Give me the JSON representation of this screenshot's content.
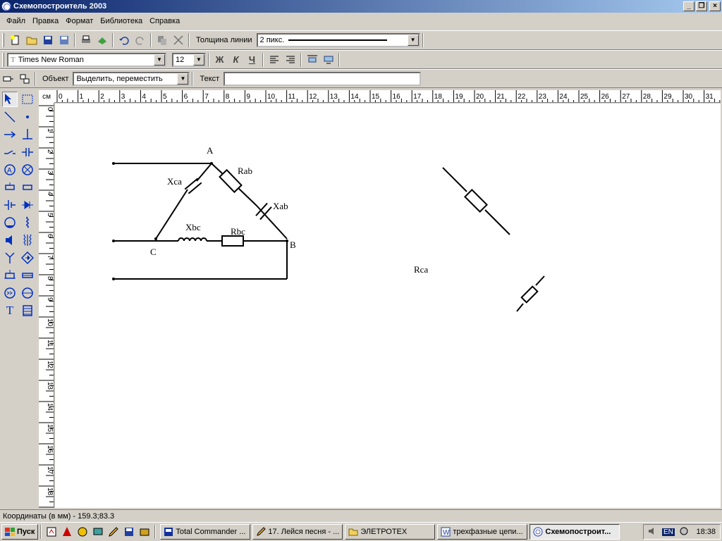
{
  "window": {
    "title": "Схемопостроитель 2003",
    "minimize": "_",
    "restore": "❐",
    "close": "×"
  },
  "menu": [
    "Файл",
    "Правка",
    "Формат",
    "Библиотека",
    "Справка"
  ],
  "toolbar1": {
    "line_width_label": "Толщина линии",
    "line_width_value": "2 пикс."
  },
  "toolbar2": {
    "font_name": "Times New Roman",
    "font_size": "12",
    "bold": "Ж",
    "italic": "К",
    "underline": "Ч"
  },
  "toolbar3": {
    "object_label": "Объект",
    "object_value": "Выделить, переместить",
    "text_label": "Текст",
    "text_value": ""
  },
  "ruler": {
    "unit": "см",
    "h_ticks": [
      "0",
      "1",
      "2",
      "3",
      "4",
      "5",
      "6",
      "7",
      "8",
      "9",
      "10",
      "11",
      "12",
      "13",
      "14",
      "15",
      "16",
      "17",
      "18",
      "19",
      "20",
      "21",
      "22",
      "23",
      "24",
      "25",
      "26",
      "27",
      "28",
      "29",
      "30",
      "31"
    ],
    "v_ticks": [
      "0",
      "1",
      "2",
      "3",
      "4",
      "5",
      "6",
      "7",
      "8",
      "9",
      "10",
      "11",
      "12",
      "13",
      "14",
      "15",
      "16",
      "17",
      "18",
      "19"
    ]
  },
  "schematic": {
    "labels": {
      "a": "A",
      "b": "B",
      "c": "C",
      "rab": "Rab",
      "xab": "Xab",
      "xca": "Xca",
      "xbc": "Xbc",
      "rbc": "Rbc",
      "rca": "Rca"
    }
  },
  "status": {
    "coordinates": "Координаты (в мм) - 159.3;83.3"
  },
  "taskbar": {
    "start": "Пуск",
    "tasks": [
      "Total Commander ...",
      "17. Лейся песня - ...",
      "ЭЛЕТРОТЕХ",
      "трехфазные цепи...",
      "Схемопостроит..."
    ],
    "lang": "EN",
    "clock": "18:38"
  }
}
